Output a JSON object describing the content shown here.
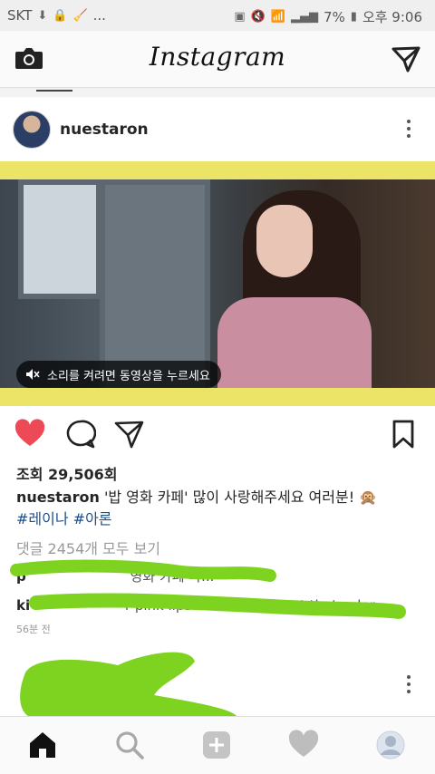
{
  "status_bar": {
    "carrier": "SKT",
    "dots": "...",
    "battery": "7%",
    "time": "오후 9:06"
  },
  "app": {
    "title": "Instagram"
  },
  "post": {
    "username": "nuestaron",
    "sound_hint": "소리를 켜려면 동영상을 누르세요",
    "views": "조회 29,506회",
    "caption_user": "nuestaron",
    "caption_text": "'밥 영화 카페' 많이 사랑해주세요 여러분! 🙊",
    "hashtags": [
      "#레이나",
      "#아론"
    ],
    "view_all_comments": "댓글 2454개 모두 보기",
    "comments": [
      {
        "prefix": "p",
        "text": "영화 카페 다..."
      },
      {
        "prefix": "ki",
        "text": "r pink lips she s so in want that color"
      }
    ],
    "time_ago": "56분 전"
  },
  "colors": {
    "like_red": "#ed4956",
    "hashtag_blue": "#1e4f87",
    "video_border": "#ebe467",
    "scribble_green": "#7ed321"
  },
  "icons": {
    "top_left": "camera-icon",
    "top_right": "direct-message-icon",
    "actions": [
      "heart-filled-icon",
      "comment-icon",
      "share-icon",
      "bookmark-icon"
    ],
    "tabs": [
      "home-icon",
      "search-icon",
      "add-post-icon",
      "activity-heart-icon",
      "profile-icon"
    ]
  }
}
